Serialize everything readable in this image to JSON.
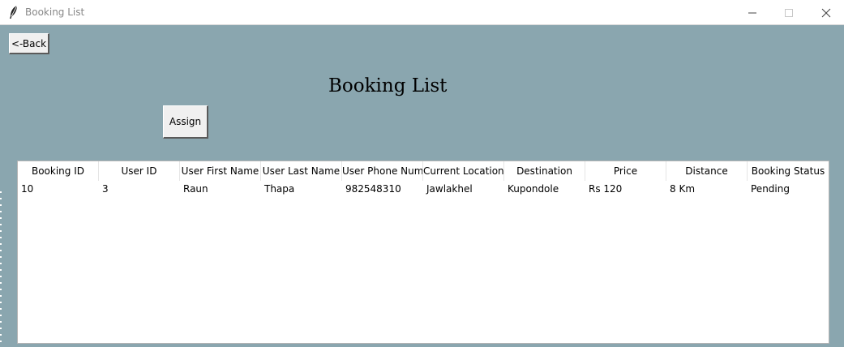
{
  "window": {
    "title": "Booking List",
    "controls": [
      "minimize-icon",
      "maximize-icon",
      "close-icon"
    ]
  },
  "toolbar": {
    "back_label": "<-Back",
    "assign_label": "Assign"
  },
  "page": {
    "heading": "Booking List"
  },
  "table": {
    "columns": [
      "Booking ID",
      "User ID",
      "User First Name",
      "User Last Name",
      "User Phone Numl",
      "Current Location",
      "Destination",
      "Price",
      "Distance",
      "Booking Status"
    ],
    "rows": [
      [
        "10",
        "3",
        "Raun",
        "Thapa",
        "982548310",
        "Jawlakhel",
        "Kupondole",
        "Rs 120",
        "8 Km",
        "Pending"
      ]
    ]
  },
  "colors": {
    "background": "#8aa6af",
    "table_background": "#ffffff",
    "button_face": "#f0f0f0"
  }
}
